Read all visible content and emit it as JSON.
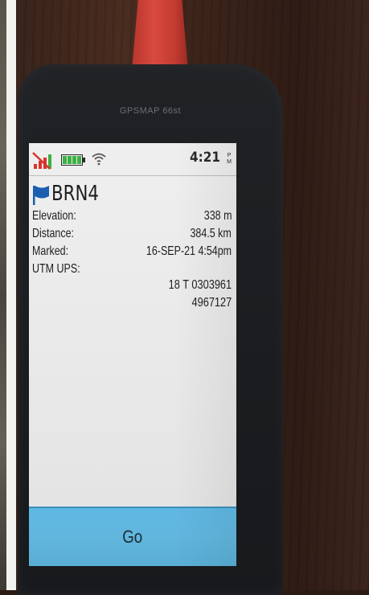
{
  "device": {
    "model": "GPSMAP 66st"
  },
  "status_bar": {
    "time": "4:21",
    "meridiem_top": "P",
    "meridiem_bottom": "M",
    "icons": [
      "no-cellular-signal-icon",
      "battery-full-icon",
      "wifi-icon"
    ]
  },
  "waypoint": {
    "name": "BRN4",
    "icon": "flag-icon",
    "fields": [
      {
        "label": "Elevation:",
        "value": "338 m"
      },
      {
        "label": "Distance:",
        "value": "384.5 km"
      },
      {
        "label": "Marked:",
        "value": "16-SEP-21 4:54pm"
      }
    ],
    "utm_label": "UTM UPS:",
    "utm_zone_easting": "18  T 0303961",
    "utm_northing": "4967127"
  },
  "actions": {
    "go_label": "Go"
  },
  "colors": {
    "screen": "#ececec",
    "go_button": "#5fb6e0",
    "flag": "#1b5fb0",
    "battery": "#3cb043",
    "signal": "#d9342b"
  }
}
